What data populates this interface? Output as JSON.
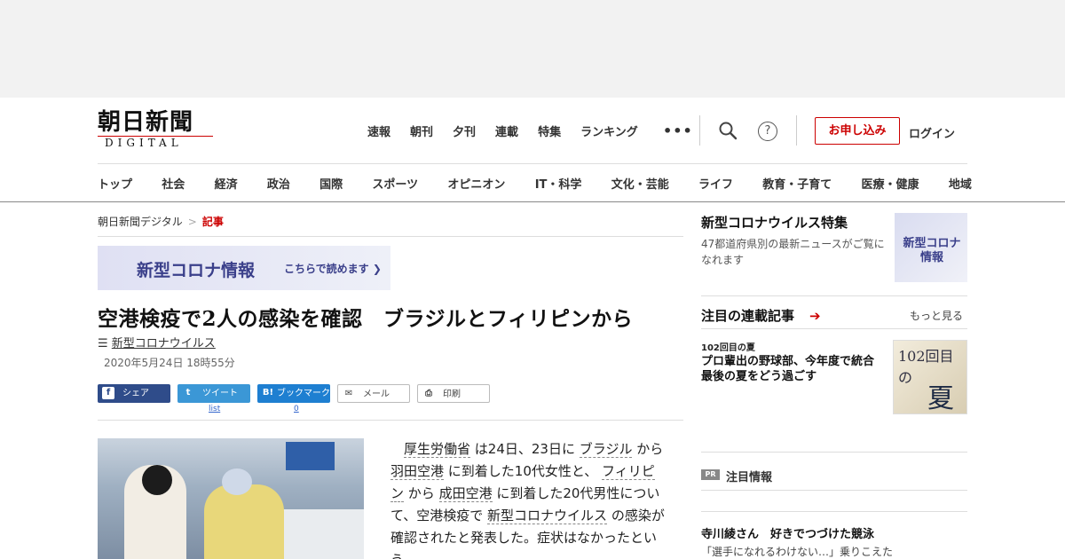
{
  "logo": {
    "main": "朝日新聞",
    "sub": "DIGITAL"
  },
  "topnav": [
    "速報",
    "朝刊",
    "夕刊",
    "連載",
    "特集",
    "ランキング"
  ],
  "topnav_more": "•••",
  "help_glyph": "?",
  "apply_button": "お申し込み",
  "login": "ログイン",
  "catnav": [
    "トップ",
    "社会",
    "経済",
    "政治",
    "国際",
    "スポーツ",
    "オピニオン",
    "IT・科学",
    "文化・芸能",
    "ライフ",
    "教育・子育て",
    "医療・健康",
    "地域"
  ],
  "breadcrumb": {
    "home": "朝日新聞デジタル",
    "sep": ">",
    "current": "記事"
  },
  "banner": {
    "title": "新型コロナ情報",
    "cta": "こちらで読めます ❯"
  },
  "article": {
    "headline": "空港検疫で2人の感染を確認　ブラジルとフィリピンから",
    "tag_icon": "☰",
    "tag": "新型コロナウイルス",
    "date": "2020年5月24日 18時55分",
    "share": {
      "facebook": {
        "icon": "f",
        "label": "シェア"
      },
      "twitter": {
        "icon": "t",
        "label": "ツイート",
        "count": "list"
      },
      "hatena": {
        "icon": "B!",
        "label": "ブックマーク",
        "count": "0"
      },
      "mail": {
        "icon": "✉",
        "label": "メール"
      },
      "print": {
        "icon": "⎙",
        "label": "印刷"
      }
    },
    "body": {
      "p1": "厚生労働省",
      "p2": " は24日、23日に ",
      "p3": "ブラジル",
      "p4": " から ",
      "p5": "羽田空港",
      "p6": " に到着した10代女性と、 ",
      "p7": "フィリピン",
      "p8": " から ",
      "p9": "成田空港",
      "p10": " に到着した20代男性について、空港検疫で ",
      "p11": "新型コロナウイルス",
      "p12": " の感染が確認されたと発表した。症状はなかったという。"
    }
  },
  "sidebar": {
    "feature": {
      "title": "新型コロナウイルス特集",
      "desc": "47都道府県別の最新ニュースがご覧になれます",
      "thumb": "新型コロナ情報"
    },
    "series": {
      "title": "注目の連載記事",
      "arrow": "➔",
      "more": "もっと見る",
      "item": {
        "kicker": "102回目の夏",
        "title": "プロ輩出の野球部、今年度で統合　最後の夏をどう過ごす",
        "thumb_top": "102回目の",
        "thumb_big": "夏"
      }
    },
    "pr": {
      "badge": "PR",
      "title": "注目情報",
      "item_title": "寺川綾さん　好きでつづけた競泳",
      "item_sub": "「選手になれるわけない…」乗りこえた"
    }
  },
  "colors": {
    "accent": "#cc0000",
    "facebook": "#2f4c8a",
    "twitter": "#3b97d6",
    "hatena": "#1e7fd1",
    "corona": "#3a3f8a"
  }
}
